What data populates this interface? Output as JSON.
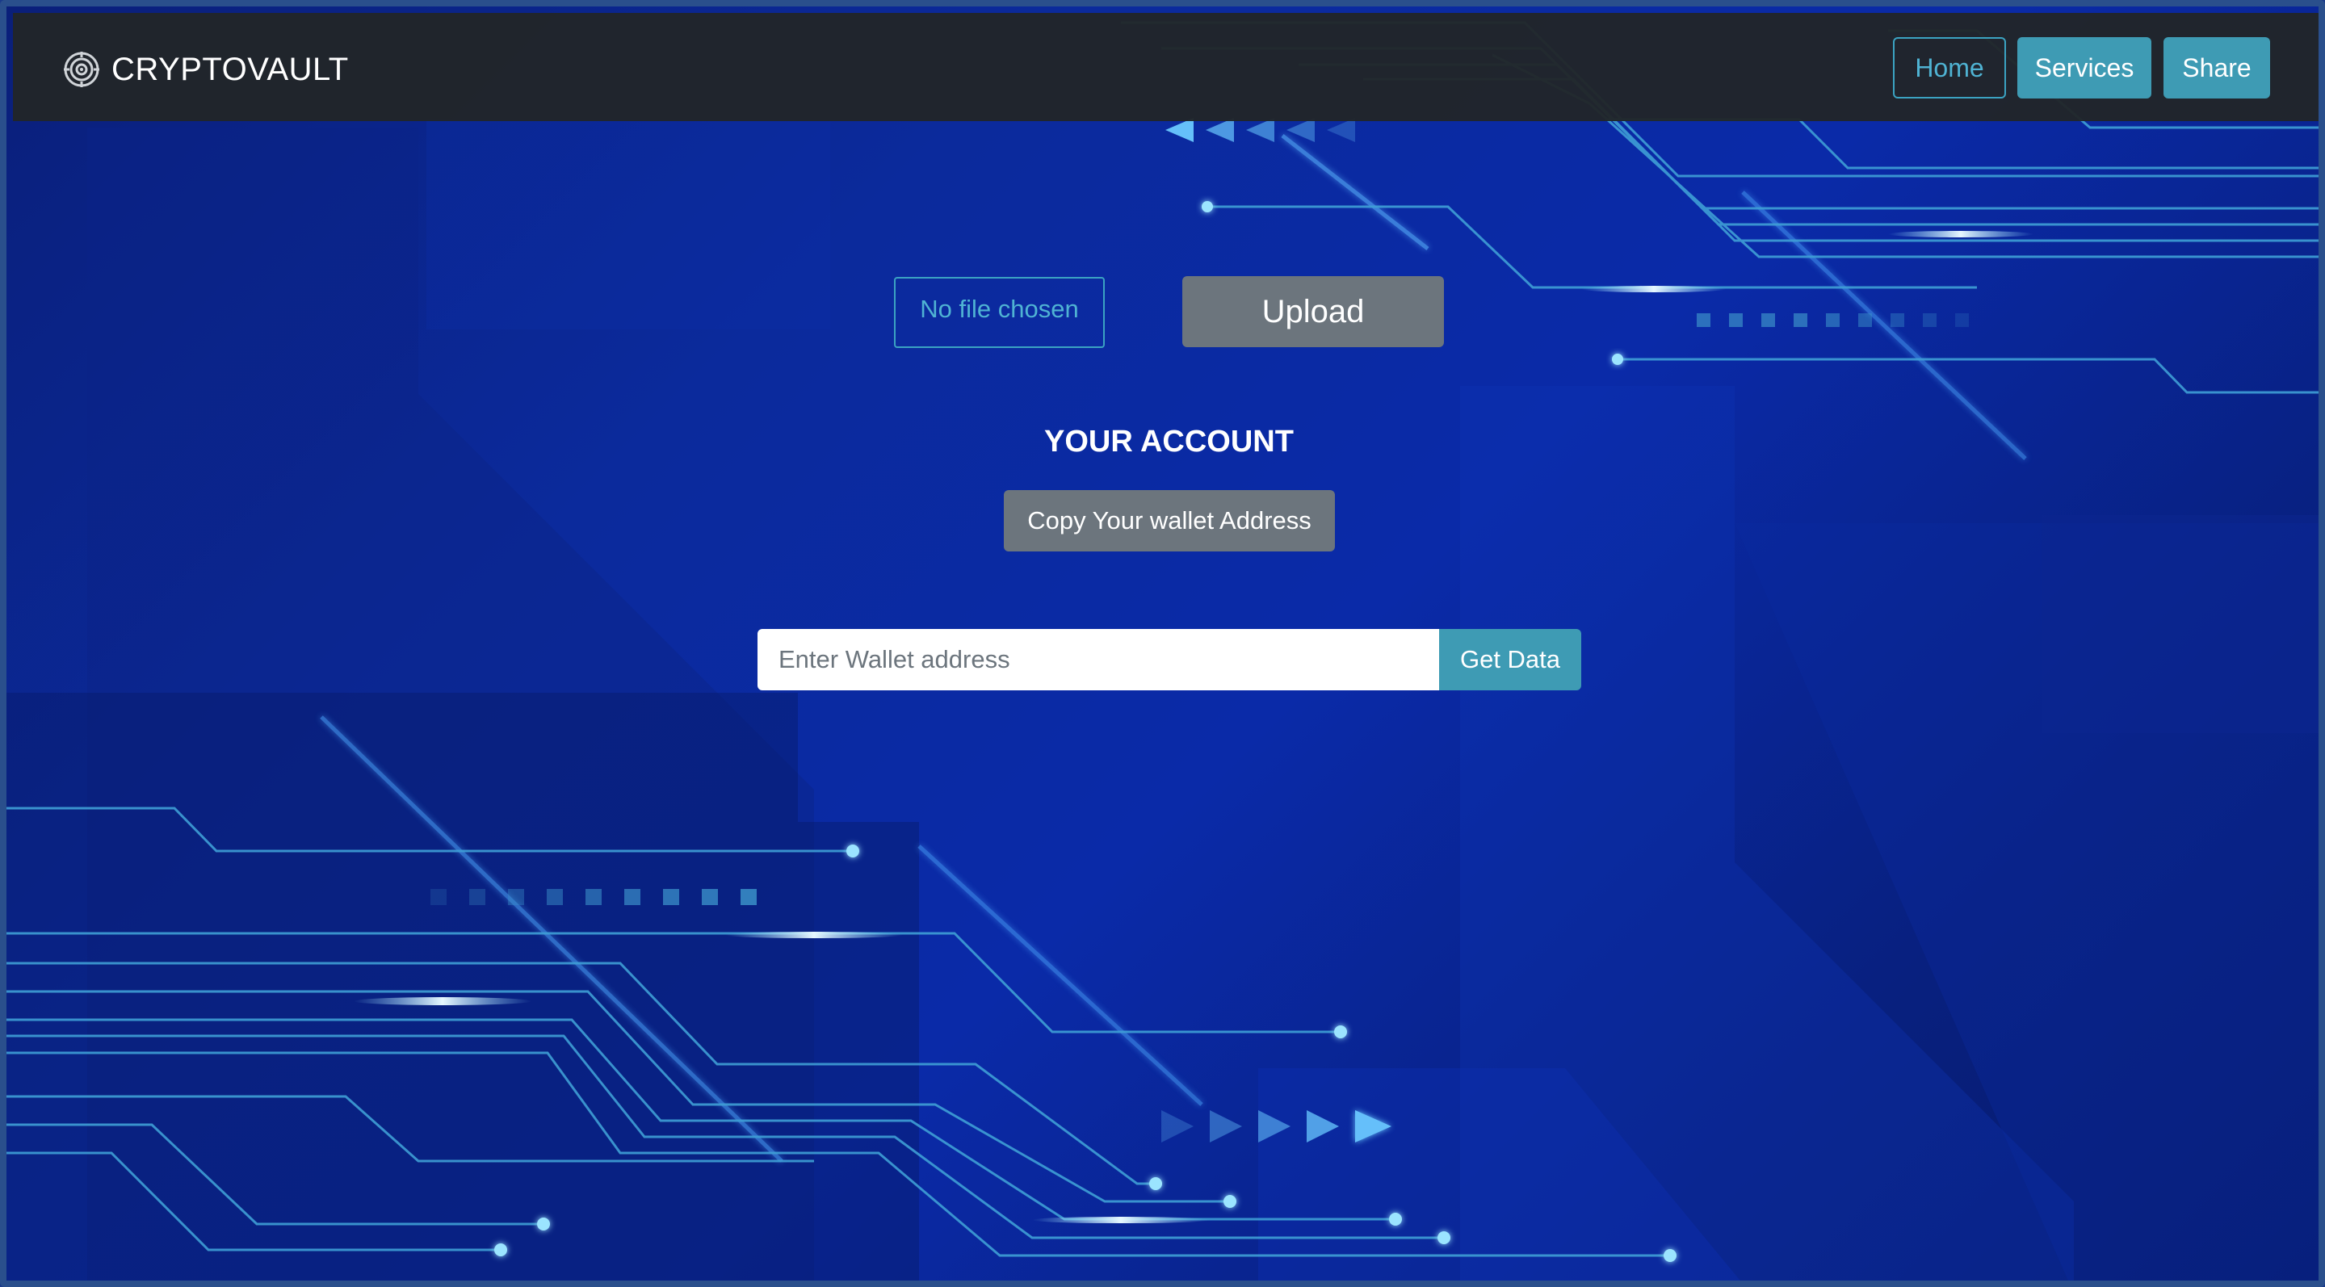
{
  "navbar": {
    "brand": {
      "icon": "target-icon",
      "title": "CRYPTOVAULT"
    },
    "links": {
      "home": "Home",
      "services": "Services",
      "share": "Share"
    }
  },
  "upload": {
    "file_status": "No file chosen",
    "button_label": "Upload"
  },
  "account": {
    "title": "YOUR ACCOUNT",
    "copy_button": "Copy Your wallet Address"
  },
  "wallet_search": {
    "input_value": "",
    "placeholder": "Enter Wallet address",
    "button_label": "Get Data"
  },
  "colors": {
    "navbar_bg": "#212529",
    "accent": "#3e9bb4",
    "secondary_button": "#6c757d",
    "background": "#0b2a9c"
  }
}
